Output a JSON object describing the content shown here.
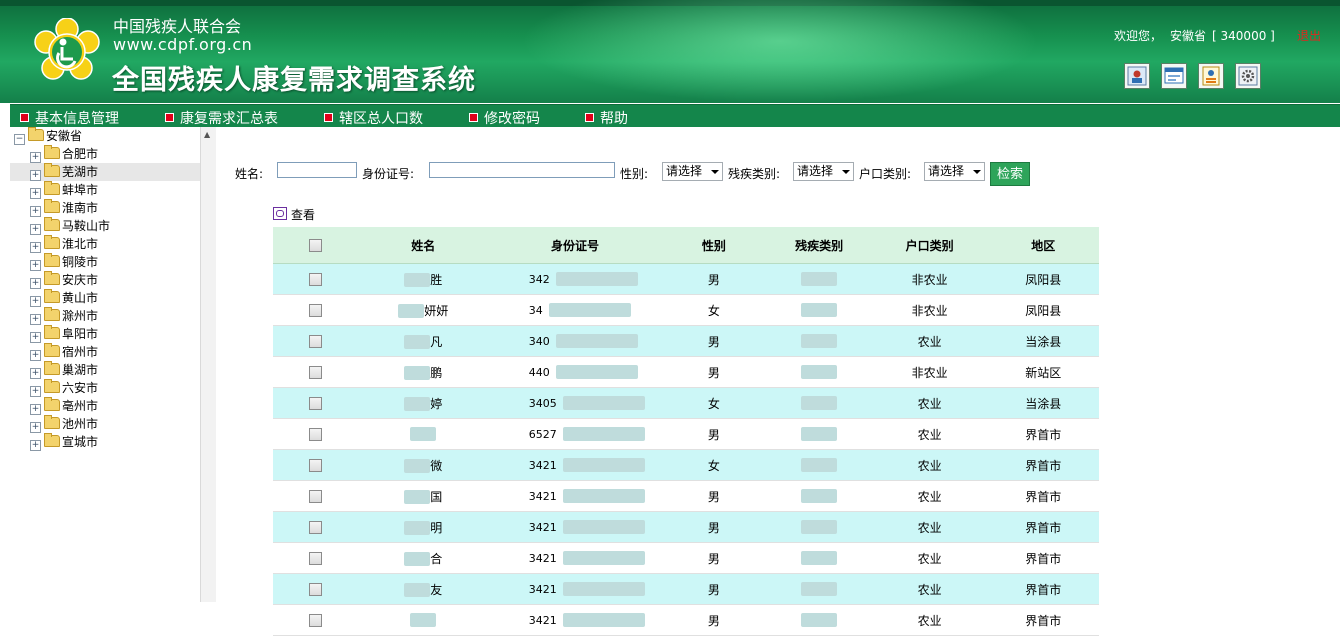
{
  "header": {
    "org_name": "中国残疾人联合会",
    "org_url": "www.cdpf.org.cn",
    "system_title": "全国残疾人康复需求调查系统",
    "welcome": "欢迎您，",
    "user": "安徽省",
    "user_code": "[ 340000 ]",
    "logout": "退出",
    "toolbar_icons": [
      "user-info-icon",
      "window-icon",
      "report-icon",
      "settings-icon"
    ]
  },
  "menu": [
    {
      "label": "基本信息管理"
    },
    {
      "label": "康复需求汇总表"
    },
    {
      "label": "辖区总人口数"
    },
    {
      "label": "修改密码"
    },
    {
      "label": "帮助"
    }
  ],
  "tree": {
    "root": "安徽省",
    "children": [
      "合肥市",
      "芜湖市",
      "蚌埠市",
      "淮南市",
      "马鞍山市",
      "淮北市",
      "铜陵市",
      "安庆市",
      "黄山市",
      "滁州市",
      "阜阳市",
      "宿州市",
      "巢湖市",
      "六安市",
      "亳州市",
      "池州市",
      "宣城市"
    ],
    "selected": "芜湖市"
  },
  "filters": {
    "name_label": "姓名:",
    "name_value": "",
    "id_label": "身份证号:",
    "id_value": "",
    "gender_label": "性别:",
    "gender_value": "请选择",
    "disability_label": "残疾类别:",
    "disability_value": "请选择",
    "hukou_label": "户口类别:",
    "hukou_value": "请选择",
    "search_button": "检索"
  },
  "view_label": "查看",
  "table": {
    "columns": [
      "姓名",
      "身份证号",
      "性别",
      "残疾类别",
      "户口类别",
      "地区"
    ],
    "rows": [
      {
        "name": "胜",
        "id": "342",
        "gender": "男",
        "hukou": "非农业",
        "region": "凤阳县"
      },
      {
        "name": "妍妍",
        "id": "34",
        "gender": "女",
        "hukou": "非农业",
        "region": "凤阳县"
      },
      {
        "name": "凡",
        "id": "340",
        "gender": "男",
        "hukou": "农业",
        "region": "当涂县"
      },
      {
        "name": "鹏",
        "id": "440",
        "gender": "男",
        "hukou": "非农业",
        "region": "新站区"
      },
      {
        "name": "婷",
        "id": "3405",
        "gender": "女",
        "hukou": "农业",
        "region": "当涂县"
      },
      {
        "name": "",
        "id": "6527",
        "gender": "男",
        "hukou": "农业",
        "region": "界首市"
      },
      {
        "name": "微",
        "id": "3421",
        "gender": "女",
        "hukou": "农业",
        "region": "界首市"
      },
      {
        "name": "国",
        "id": "3421",
        "gender": "男",
        "hukou": "农业",
        "region": "界首市"
      },
      {
        "name": "明",
        "id": "3421",
        "gender": "男",
        "hukou": "农业",
        "region": "界首市"
      },
      {
        "name": "合",
        "id": "3421",
        "gender": "男",
        "hukou": "农业",
        "region": "界首市"
      },
      {
        "name": "友",
        "id": "3421",
        "gender": "男",
        "hukou": "农业",
        "region": "界首市"
      },
      {
        "name": "",
        "id": "3421",
        "gender": "男",
        "hukou": "农业",
        "region": "界首市"
      }
    ]
  }
}
